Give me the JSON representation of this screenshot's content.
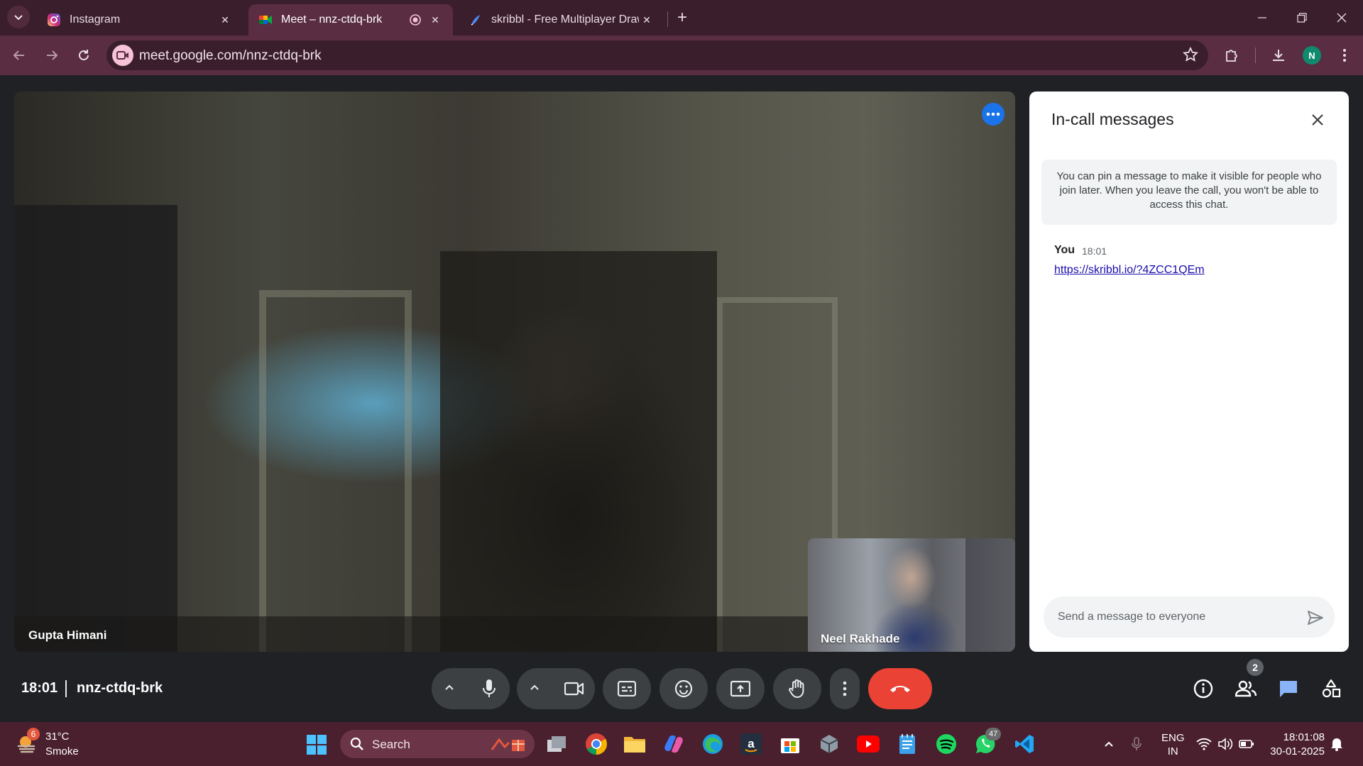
{
  "browser": {
    "tabs": [
      {
        "title": "Instagram",
        "icon": "instagram-icon",
        "active": false
      },
      {
        "title": "Meet – nnz-ctdq-brk",
        "icon": "google-meet-icon",
        "active": true
      },
      {
        "title": "skribbl - Free Multiplayer Drawi",
        "icon": "skribbl-icon",
        "active": false
      }
    ],
    "url": "meet.google.com/nnz-ctdq-brk",
    "profile_initial": "N",
    "accent": "#5a2d42"
  },
  "meet": {
    "main_participant": "Gupta Himani",
    "self_participant": "Neel Rakhade",
    "time": "18:01",
    "meeting_code": "nnz-ctdq-brk",
    "people_count": "2",
    "hangup_color": "#ea4335"
  },
  "chat": {
    "title": "In-call messages",
    "info": "You can pin a message to make it visible for people who join later. When you leave the call, you won't be able to access this chat.",
    "messages": [
      {
        "sender": "You",
        "time": "18:01",
        "text": "https://skribbl.io/?4ZCC1QEm"
      }
    ],
    "input_placeholder": "Send a message to everyone"
  },
  "taskbar": {
    "weather_badge": "6",
    "weather_temp": "31°C",
    "weather_condition": "Smoke",
    "search_label": "Search",
    "whatsapp_badge": "47",
    "language_line1": "ENG",
    "language_line2": "IN",
    "clock_time": "18:01:08",
    "clock_date": "30-01-2025"
  }
}
